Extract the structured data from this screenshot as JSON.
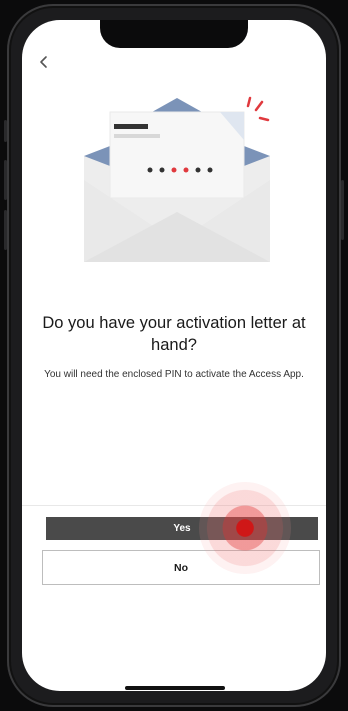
{
  "screen": {
    "back_label": "<",
    "title": "Do you have your activation letter at hand?",
    "subtitle": "You will need the enclosed PIN to activate the Access App.",
    "buttons": {
      "yes_label": "Yes",
      "no_label": "No"
    }
  },
  "icons": {
    "back": "chevron-left-icon",
    "illustration": "envelope-letter-icon",
    "tap": "tap-indicator"
  },
  "colors": {
    "primary_button_bg": "#4a4a4a",
    "accent_red": "#e0393e",
    "envelope_blue": "#7b93b8",
    "envelope_gray": "#e7e7e7"
  }
}
